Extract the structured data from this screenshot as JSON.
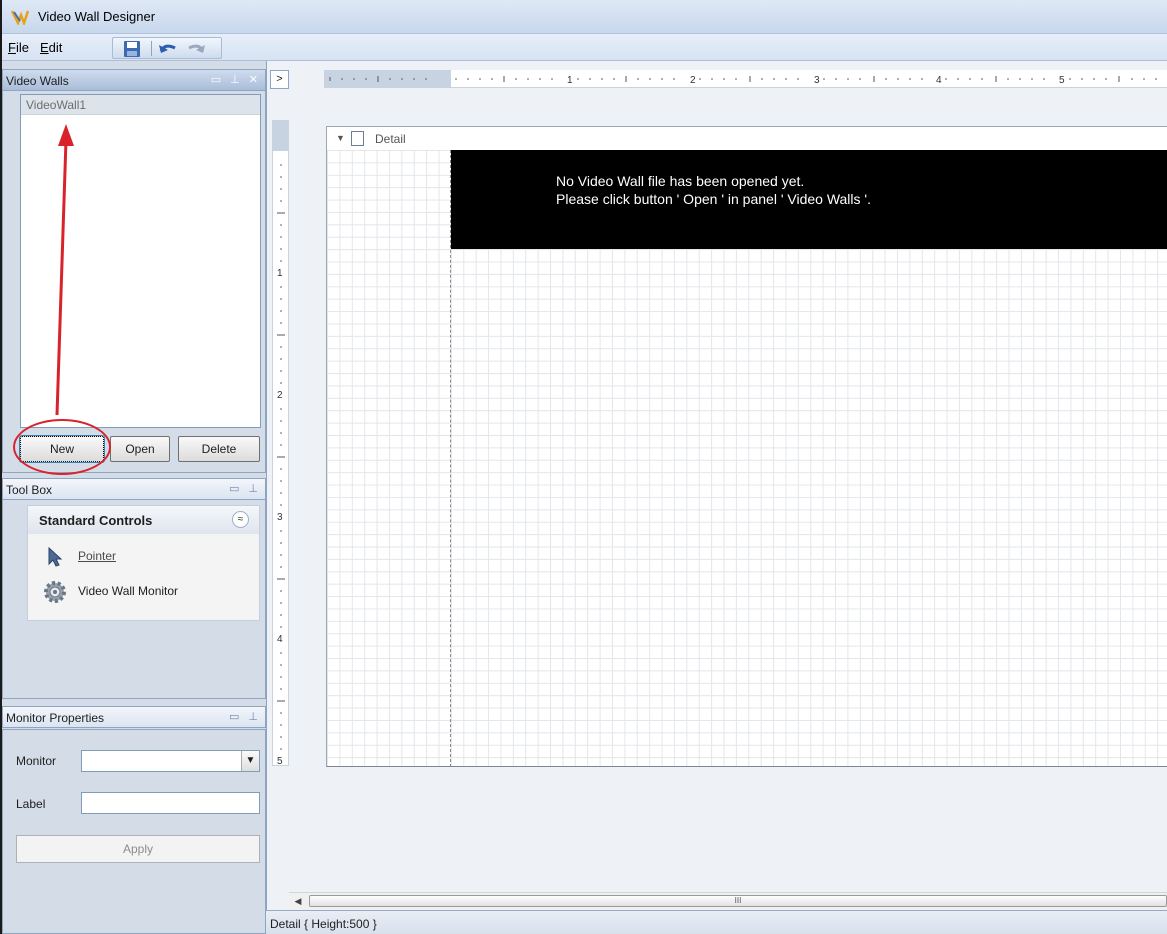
{
  "app": {
    "title": "Video Wall Designer"
  },
  "menu": {
    "file": "File",
    "edit": "Edit"
  },
  "toolbar": {
    "icons": [
      "save-icon",
      "undo-icon",
      "redo-icon"
    ]
  },
  "video_walls_panel": {
    "title": "Video Walls",
    "items": [
      {
        "label": "VideoWall1"
      }
    ],
    "buttons": {
      "new": "New",
      "open": "Open",
      "delete": "Delete"
    }
  },
  "toolbox": {
    "title": "Tool Box",
    "group_title": "Standard Controls",
    "collapse_glyph": "≈",
    "tools": [
      {
        "label": "Pointer",
        "icon": "pointer-icon"
      },
      {
        "label": "Video Wall Monitor",
        "icon": "gear-icon"
      }
    ]
  },
  "monitor_properties": {
    "title": "Monitor Properties",
    "monitor_label": "Monitor",
    "monitor_value": "",
    "label_label": "Label",
    "label_value": "",
    "apply": "Apply"
  },
  "designer": {
    "band_title": "Detail",
    "message_line1": "No Video Wall file has been opened yet.",
    "message_line2": "Please click button ' Open ' in panel ' Video Walls '.",
    "h_ruler_numbers": [
      "1",
      "2",
      "3",
      "4",
      "5"
    ],
    "v_ruler_numbers": [
      "1",
      "2",
      "3",
      "4",
      "5"
    ],
    "scroll_thumb_glyph": "III"
  },
  "status": {
    "text": "Detail { Height:500 }"
  },
  "annotation": {
    "color": "#d9232b"
  }
}
